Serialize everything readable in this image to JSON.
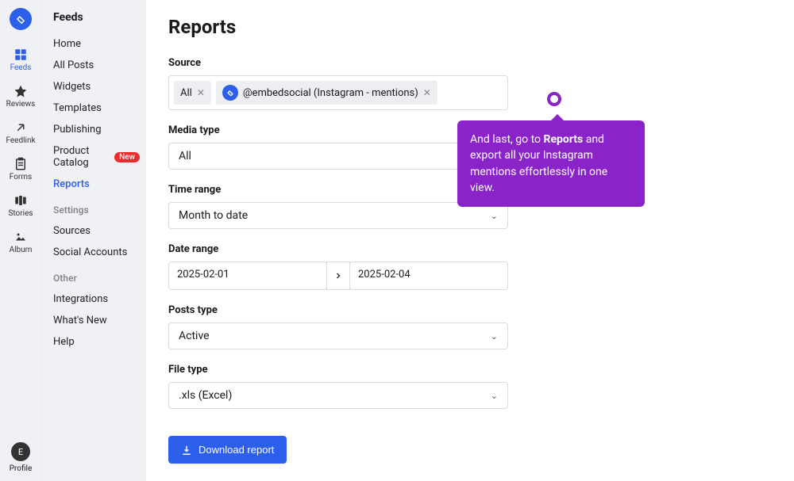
{
  "iconRail": {
    "items": [
      {
        "name": "feeds",
        "label": "Feeds",
        "active": true
      },
      {
        "name": "reviews",
        "label": "Reviews"
      },
      {
        "name": "feedlink",
        "label": "Feedlink"
      },
      {
        "name": "forms",
        "label": "Forms"
      },
      {
        "name": "stories",
        "label": "Stories"
      },
      {
        "name": "album",
        "label": "Album"
      }
    ],
    "profile": {
      "initial": "E",
      "label": "Profile"
    }
  },
  "sidebar": {
    "heading": "Feeds",
    "primary": [
      {
        "label": "Home"
      },
      {
        "label": "All Posts"
      },
      {
        "label": "Widgets"
      },
      {
        "label": "Templates"
      },
      {
        "label": "Publishing"
      },
      {
        "label": "Product Catalog",
        "badge": "New"
      },
      {
        "label": "Reports",
        "active": true
      }
    ],
    "settingsLabel": "Settings",
    "settings": [
      {
        "label": "Sources"
      },
      {
        "label": "Social Accounts"
      }
    ],
    "otherLabel": "Other",
    "other": [
      {
        "label": "Integrations"
      },
      {
        "label": "What's New"
      },
      {
        "label": "Help"
      }
    ]
  },
  "page": {
    "title": "Reports",
    "source": {
      "label": "Source",
      "tags": [
        {
          "text": "All"
        },
        {
          "text": "@embedsocial (Instagram - mentions)",
          "hasLogo": true
        }
      ]
    },
    "mediaType": {
      "label": "Media type",
      "value": "All"
    },
    "timeRange": {
      "label": "Time range",
      "value": "Month to date"
    },
    "dateRange": {
      "label": "Date range",
      "start": "2025-02-01",
      "end": "2025-02-04"
    },
    "postsType": {
      "label": "Posts type",
      "value": "Active"
    },
    "fileType": {
      "label": "File type",
      "value": ".xls (Excel)"
    },
    "downloadLabel": "Download report"
  },
  "tooltip": {
    "pre": "And last, go to ",
    "bold": "Reports",
    "post": " and export all your Instagram mentions effortlessly in one view."
  }
}
